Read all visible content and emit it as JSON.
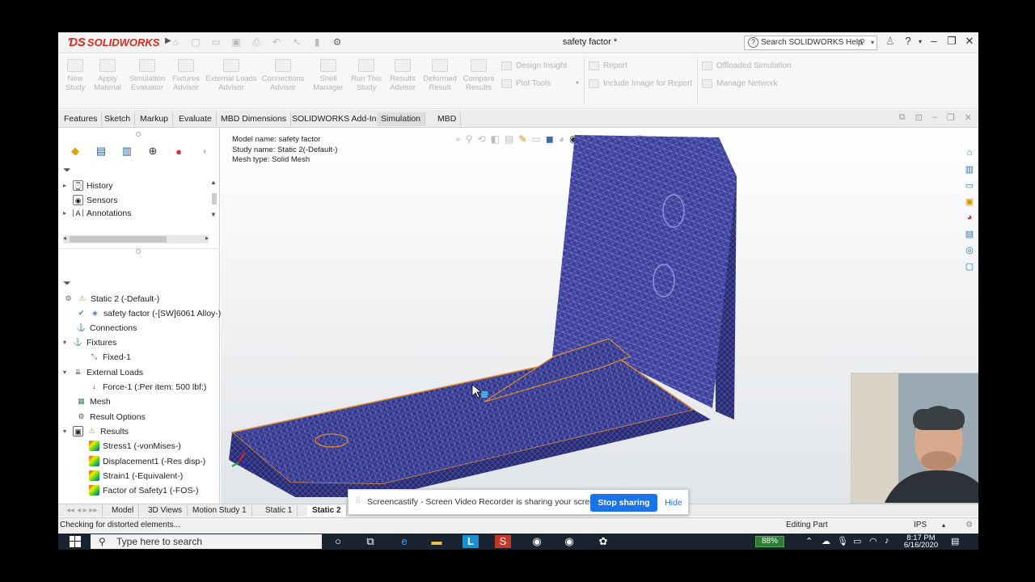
{
  "app": {
    "logo_text": "SOLIDWORKS",
    "doc_title": "safety factor *",
    "help_search_placeholder": "Search SOLIDWORKS Help"
  },
  "command_manager": {
    "tools": [
      {
        "label": "New Study"
      },
      {
        "label": "Apply Material"
      },
      {
        "label": "Simulation Evaluator"
      },
      {
        "label": "Fixtures Advisor"
      },
      {
        "label": "External Loads Advisor"
      },
      {
        "label": "Connections Advisor"
      },
      {
        "label": "Shell Manager"
      },
      {
        "label": "Run This Study"
      },
      {
        "label": "Results Advisor"
      },
      {
        "label": "Deformed Result"
      },
      {
        "label": "Compare Results"
      }
    ],
    "rows": {
      "design_insight": "Design Insight",
      "plot_tools": "Plot Tools",
      "report": "Report",
      "include_image": "Include Image for Report",
      "offloaded": "Offloaded Simulation",
      "manage_network": "Manage Network"
    }
  },
  "tabs": [
    "Features",
    "Sketch",
    "Markup",
    "Evaluate",
    "MBD Dimensions",
    "SOLIDWORKS Add-Ins",
    "Simulation",
    "MBD"
  ],
  "active_tab": "Simulation",
  "feature_tree": {
    "history": "History",
    "sensors": "Sensors",
    "annotations": "Annotations"
  },
  "sim_tree": {
    "study": "Static 2 (-Default-)",
    "part": "safety factor (-[SW]6061 Alloy-)",
    "connections": "Connections",
    "fixtures": "Fixtures",
    "fixed": "Fixed-1",
    "external_loads": "External Loads",
    "force": "Force-1 (:Per item: 500 lbf:)",
    "mesh": "Mesh",
    "result_options": "Result Options",
    "results": "Results",
    "stress": "Stress1 (-vonMises-)",
    "displacement": "Displacement1 (-Res disp-)",
    "strain": "Strain1 (-Equivalent-)",
    "fos": "Factor of Safety1 (-FOS-)"
  },
  "model_info": {
    "model_name": "Model name: safety factor",
    "study_name": "Study name: Static 2(-Default-)",
    "mesh_type": "Mesh type: Solid Mesh"
  },
  "bottom_tabs": [
    "Model",
    "3D Views",
    "Motion Study 1",
    "Static 1",
    "Static 2"
  ],
  "status": {
    "left": "Checking for distorted elements...",
    "mode": "Editing Part",
    "units": "IPS"
  },
  "sharebar": {
    "message": "Screencastify - Screen Video Recorder is sharing your screen.",
    "stop": "Stop sharing",
    "hide": "Hide"
  },
  "taskbar": {
    "search_placeholder": "Type here to search",
    "battery": "88%",
    "time": "8:17 PM",
    "date": "6/16/2020"
  },
  "colors": {
    "mesh_blue": "#3b3f9a",
    "edge_orange": "#e08a2c",
    "brand_red": "#d52b1e",
    "share_blue": "#1a73e8",
    "taskbar": "#1a2430"
  }
}
